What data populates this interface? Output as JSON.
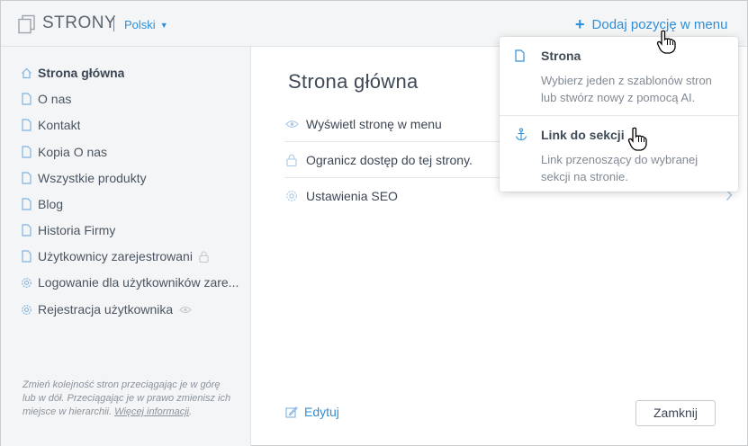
{
  "header": {
    "title": "STRONY",
    "language": "Polski",
    "add_label": "Dodaj pozycję w menu"
  },
  "sidebar": {
    "items": [
      {
        "label": "Strona główna",
        "icon": "home-icon"
      },
      {
        "label": "O nas",
        "icon": "page-icon"
      },
      {
        "label": "Kontakt",
        "icon": "page-icon"
      },
      {
        "label": "Kopia O nas",
        "icon": "page-icon"
      },
      {
        "label": "Wszystkie produkty",
        "icon": "page-icon"
      },
      {
        "label": "Blog",
        "icon": "page-icon"
      },
      {
        "label": "Historia Firmy",
        "icon": "page-icon"
      },
      {
        "label": "Użytkownicy zarejestrowani",
        "icon": "page-icon",
        "tail": "lock-icon"
      },
      {
        "label": "Logowanie dla użytkowników zare...",
        "icon": "gear-icon"
      },
      {
        "label": "Rejestracja użytkownika",
        "icon": "gear-icon",
        "tail": "eye-icon"
      }
    ],
    "note_text": "Zmień kolejność stron przeciągając je w górę lub w dół. Przeciągając je w prawo zmienisz ich miejsce w hierarchii.",
    "note_link": "Więcej informacji"
  },
  "main": {
    "title": "Strona główna",
    "options": [
      {
        "label": "Wyświetl stronę w menu",
        "icon": "eye-icon"
      },
      {
        "label": "Ogranicz dostęp do tej strony.",
        "icon": "lock-icon"
      },
      {
        "label": "Ustawienia SEO",
        "icon": "gear-icon"
      }
    ],
    "edit_label": "Edytuj",
    "close_label": "Zamknij"
  },
  "dropdown": {
    "items": [
      {
        "title": "Strona",
        "description": "Wybierz jeden z szablonów stron lub stwórz nowy z pomocą AI.",
        "icon": "page-icon"
      },
      {
        "title": "Link do sekcji",
        "description": "Link przenoszący do wybranej sekcji na stronie.",
        "icon": "anchor-icon"
      }
    ]
  },
  "colors": {
    "accent": "#2f8fd8",
    "sidebar_bg": "#f4f5f6",
    "text": "#3b4754"
  }
}
